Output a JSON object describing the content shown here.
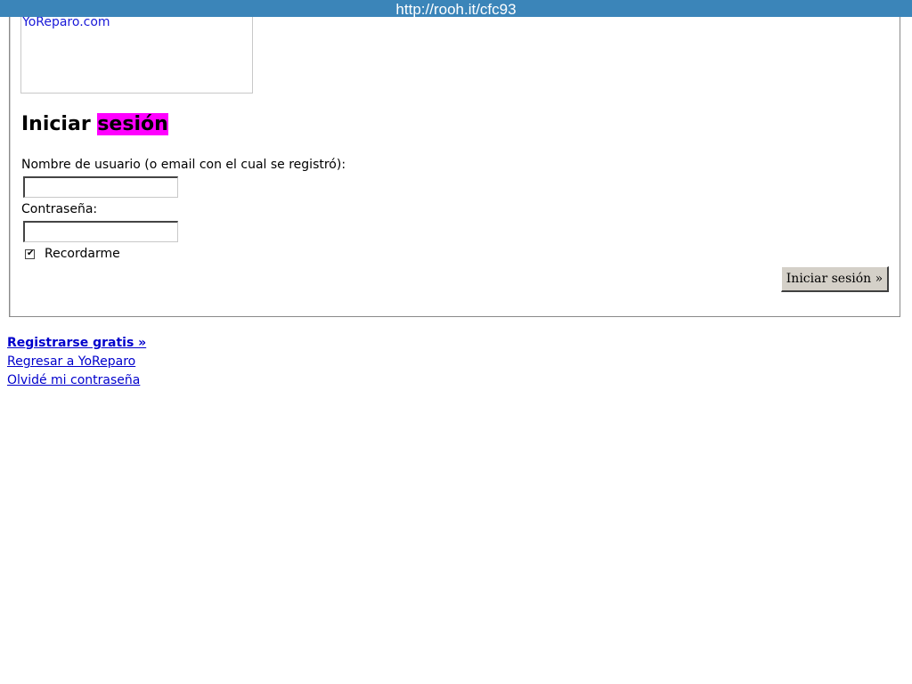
{
  "url_bar": {
    "text": "http://rooh.it/cfc93"
  },
  "logo": {
    "text": "YoReparo.com"
  },
  "login": {
    "heading_part1": "Iniciar ",
    "heading_part2": "sesión",
    "username_label": "Nombre de usuario (o email con el cual se registró):",
    "username_value": "",
    "password_label": "Contraseña:",
    "password_value": "",
    "remember_label": "Recordarme",
    "remember_checked": true,
    "submit_label": "Iniciar sesión »"
  },
  "links": {
    "register": "Registrarse gratis »",
    "back": "Regresar a YoReparo",
    "forgot": "Olvidé mi contraseña"
  },
  "colors": {
    "url_bar_bg": "#3b85b9",
    "highlight": "#ff00ff",
    "link": "#0000cc",
    "button_bg": "#d4d0c8"
  }
}
